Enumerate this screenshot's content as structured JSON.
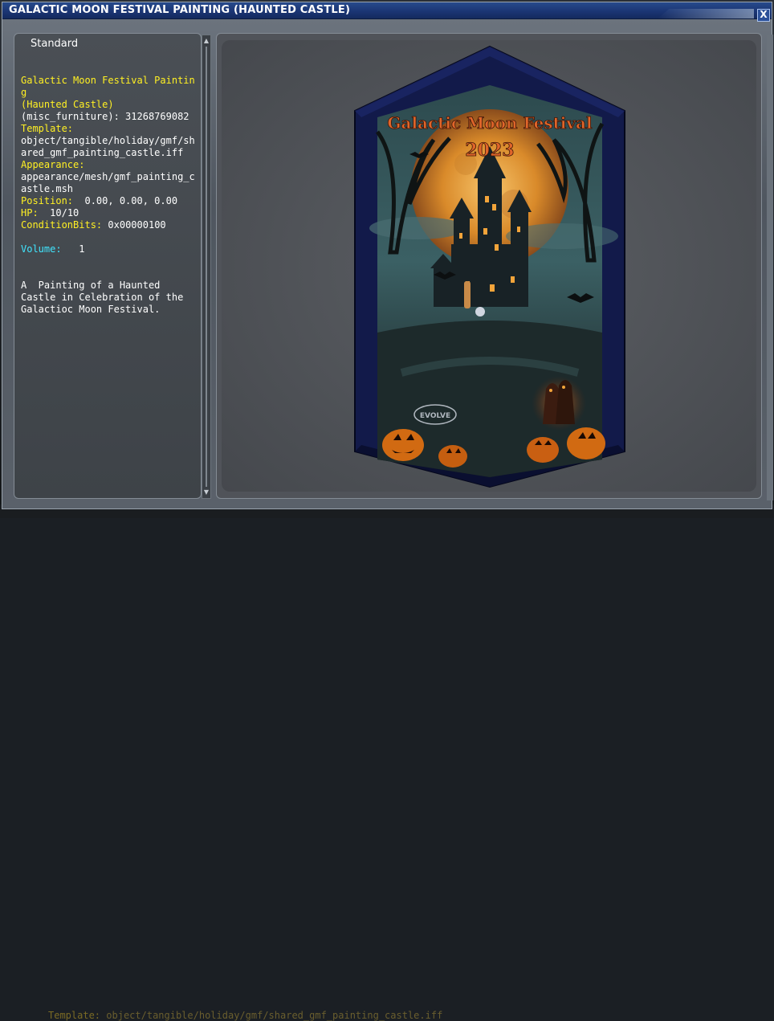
{
  "window": {
    "title": "GALACTIC MOON FESTIVAL PAINTING (HAUNTED CASTLE)",
    "close_label": "X"
  },
  "info_panel": {
    "header": "Standard",
    "name_line1": "Galactic Moon Festival Painting",
    "name_line2": "(Haunted Castle)",
    "object_type": "(misc_furniture): 31268769082",
    "template_label": "Template:",
    "template_value": "object/tangible/holiday/gmf/shared_gmf_painting_castle.iff",
    "appearance_label": "Appearance:",
    "appearance_value": "appearance/mesh/gmf_painting_castle.msh",
    "position_label": "Position:",
    "position_value": "0.00, 0.00, 0.00",
    "hp_label": "HP:",
    "hp_value": "10/10",
    "condition_label": "ConditionBits:",
    "condition_value": "0x00000100",
    "volume_label": "Volume:",
    "volume_value": "1",
    "description": "A  Painting of a Haunted Castle in Celebration of the Galactioc Moon Festival."
  },
  "painting": {
    "headline": "Galactic Moon Festival",
    "year": "2023",
    "logo_text": "EVOLVE"
  },
  "background": {
    "bottom_label": "Template:",
    "bottom_value": "object/tangible/holiday/gmf/shared_gmf_painting_castle.iff"
  },
  "colors": {
    "label_yellow": "#fff023",
    "label_cyan": "#40e6ff",
    "titlebar_blue": "#1a3472"
  }
}
